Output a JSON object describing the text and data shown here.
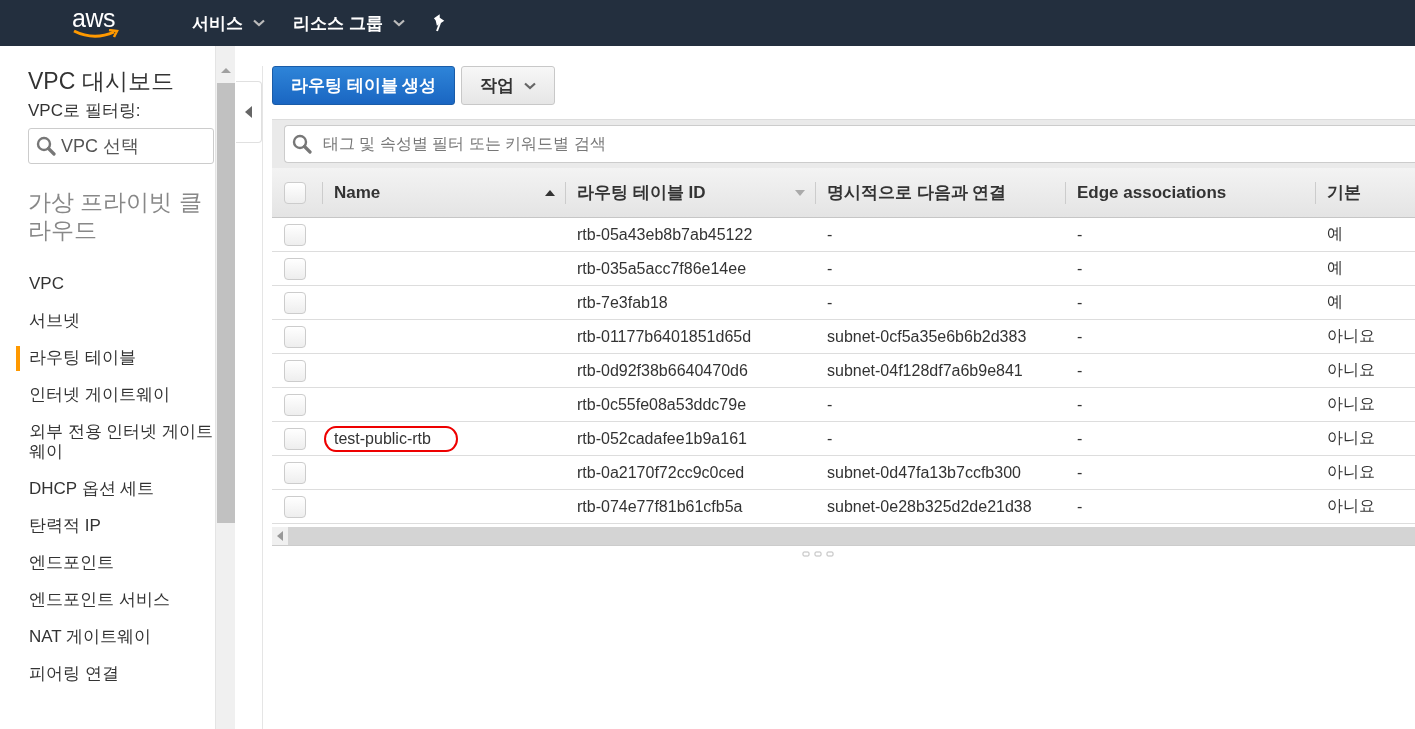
{
  "top_nav": {
    "logo": "aws",
    "menus": [
      {
        "label": "서비스",
        "dropdown": true
      },
      {
        "label": "리소스 그룹",
        "dropdown": true
      }
    ]
  },
  "sidebar": {
    "title": "VPC 대시보드",
    "filter_label": "VPC로 필터링:",
    "filter_field": {
      "placeholder": "VPC 선택"
    },
    "section": "가상 프라이빗 클라우드",
    "items": [
      {
        "label": "VPC",
        "selected": false
      },
      {
        "label": "서브넷",
        "selected": false
      },
      {
        "label": "라우팅 테이블",
        "selected": true
      },
      {
        "label": "인터넷 게이트웨이",
        "selected": false
      },
      {
        "label": "외부 전용 인터넷 게이트웨이",
        "selected": false
      },
      {
        "label": "DHCP 옵션 세트",
        "selected": false
      },
      {
        "label": "탄력적 IP",
        "selected": false
      },
      {
        "label": "엔드포인트",
        "selected": false
      },
      {
        "label": "엔드포인트 서비스",
        "selected": false
      },
      {
        "label": "NAT 게이트웨이",
        "selected": false
      },
      {
        "label": "피어링 연결",
        "selected": false
      }
    ]
  },
  "toolbar": {
    "buttons": [
      {
        "label": "라우팅 테이블 생성",
        "kind": "primary"
      },
      {
        "label": "작업",
        "kind": "dropdown"
      }
    ]
  },
  "search": {
    "placeholder": "태그 및 속성별 필터 또는 키워드별 검색"
  },
  "table": {
    "all_checked": false,
    "columns": [
      {
        "label": "Name",
        "sortable": true,
        "sorted": true
      },
      {
        "label": "라우팅 테이블 ID",
        "sortable": true,
        "sorted": false
      },
      {
        "label": "명시적으로 다음과 연결",
        "sortable": false,
        "sorted": false
      },
      {
        "label": "Edge associations",
        "sortable": false,
        "sorted": false
      },
      {
        "label": "기본",
        "sortable": false,
        "sorted": false
      }
    ],
    "rows": [
      {
        "checked": false,
        "highlighted": false,
        "cells": [
          "",
          "rtb-05a43eb8b7ab45122",
          "-",
          "-",
          "예"
        ]
      },
      {
        "checked": false,
        "highlighted": false,
        "cells": [
          "",
          "rtb-035a5acc7f86e14ee",
          "-",
          "-",
          "예"
        ]
      },
      {
        "checked": false,
        "highlighted": false,
        "cells": [
          "",
          "rtb-7e3fab18",
          "-",
          "-",
          "예"
        ]
      },
      {
        "checked": false,
        "highlighted": false,
        "cells": [
          "",
          "rtb-01177b6401851d65d",
          "subnet-0cf5a35e6b6b2d383",
          "-",
          "아니요"
        ]
      },
      {
        "checked": false,
        "highlighted": false,
        "cells": [
          "",
          "rtb-0d92f38b6640470d6",
          "subnet-04f128df7a6b9e841",
          "-",
          "아니요"
        ]
      },
      {
        "checked": false,
        "highlighted": false,
        "cells": [
          "",
          "rtb-0c55fe08a53ddc79e",
          "-",
          "-",
          "아니요"
        ]
      },
      {
        "checked": false,
        "highlighted": true,
        "cells": [
          "test-public-rtb",
          "rtb-052cadafee1b9a161",
          "-",
          "-",
          "아니요"
        ]
      },
      {
        "checked": false,
        "highlighted": false,
        "cells": [
          "",
          "rtb-0a2170f72cc9c0ced",
          "subnet-0d47fa13b7ccfb300",
          "-",
          "아니요"
        ]
      },
      {
        "checked": false,
        "highlighted": false,
        "cells": [
          "",
          "rtb-074e77f81b61cfb5a",
          "subnet-0e28b325d2de21d38",
          "-",
          "아니요"
        ]
      }
    ]
  }
}
